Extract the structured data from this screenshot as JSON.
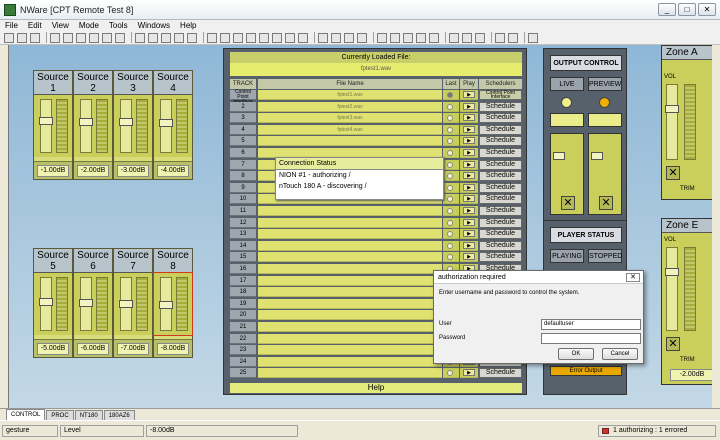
{
  "window": {
    "title": "NWare [CPT Remote Test 8]",
    "min": "_",
    "max": "□",
    "close": "✕"
  },
  "menu": [
    "File",
    "Edit",
    "View",
    "Mode",
    "Tools",
    "Windows",
    "Help"
  ],
  "sources": [
    {
      "label": "Source 1",
      "db": "-1.00dB",
      "fader": 0.62
    },
    {
      "label": "Source 2",
      "db": "-2.00dB",
      "fader": 0.6
    },
    {
      "label": "Source 3",
      "db": "-3.00dB",
      "fader": 0.58
    },
    {
      "label": "Source 4",
      "db": "-4.00dB",
      "fader": 0.56
    },
    {
      "label": "Source 5",
      "db": "-5.00dB",
      "fader": 0.54
    },
    {
      "label": "Source 6",
      "db": "-6.00dB",
      "fader": 0.52
    },
    {
      "label": "Source 7",
      "db": "-7.00dB",
      "fader": 0.5
    },
    {
      "label": "Source 8",
      "db": "-8.00dB",
      "fader": 0.48
    }
  ],
  "player": {
    "header": "Currently Loaded File:",
    "loaded_file": "fptest1.wav",
    "col_track": "TRACK",
    "col_file": "File Name",
    "col_last": "Last",
    "col_play": "Play",
    "col_sched": "Schedulers",
    "cpi_label": "Control Point Interface",
    "cpi_sched": "Control Point Interface",
    "rows": [
      {
        "n": "",
        "file": "fptest1.wav"
      },
      {
        "n": "2",
        "file": "fptest2.wav"
      },
      {
        "n": "3",
        "file": "fptest3.wav"
      },
      {
        "n": "4",
        "file": "fptest4.wav"
      },
      {
        "n": "5",
        "file": ""
      },
      {
        "n": "6",
        "file": ""
      },
      {
        "n": "7",
        "file": ""
      },
      {
        "n": "8",
        "file": ""
      },
      {
        "n": "9",
        "file": ""
      },
      {
        "n": "10",
        "file": ""
      },
      {
        "n": "11",
        "file": ""
      },
      {
        "n": "12",
        "file": ""
      },
      {
        "n": "13",
        "file": ""
      },
      {
        "n": "14",
        "file": ""
      },
      {
        "n": "15",
        "file": ""
      },
      {
        "n": "16",
        "file": ""
      },
      {
        "n": "17",
        "file": ""
      },
      {
        "n": "18",
        "file": ""
      },
      {
        "n": "19",
        "file": ""
      },
      {
        "n": "20",
        "file": ""
      },
      {
        "n": "21",
        "file": ""
      },
      {
        "n": "22",
        "file": ""
      },
      {
        "n": "23",
        "file": ""
      },
      {
        "n": "24",
        "file": ""
      },
      {
        "n": "25",
        "file": ""
      }
    ],
    "schedule_label": "Schedule",
    "help": "Help"
  },
  "output_control": {
    "title": "OUTPUT CONTROL",
    "live": "LIVE",
    "preview": "PREVIEW"
  },
  "player_status": {
    "title": "PLAYER STATUS",
    "playing": "PLAYING",
    "stopped": "STOPPED",
    "error_output": "Error Output"
  },
  "zones": [
    {
      "label": "Zone A",
      "vol": "VOL",
      "trim": "TRIM"
    },
    {
      "label": "Zone E",
      "vol": "VOL",
      "trim": "TRIM",
      "db": "-2.00dB"
    }
  ],
  "conn": {
    "title": "Connection Status",
    "l1": "NION #1 - authorizing /",
    "l2": "nTouch 180 A - discovering /"
  },
  "auth": {
    "title": "authorization required",
    "close": "✕",
    "message": "Enter username and password to control the system.",
    "user_label": "User",
    "user_value": "defaultuser",
    "pass_label": "Password",
    "ok": "OK",
    "cancel": "Cancel"
  },
  "tabs": [
    "CONTROL",
    "PROC",
    "NT180",
    "180AZ6"
  ],
  "status": {
    "mode": "gesture",
    "field": "Level",
    "value": "-8.00dB",
    "right": "1 authorizing : 1 errored"
  }
}
